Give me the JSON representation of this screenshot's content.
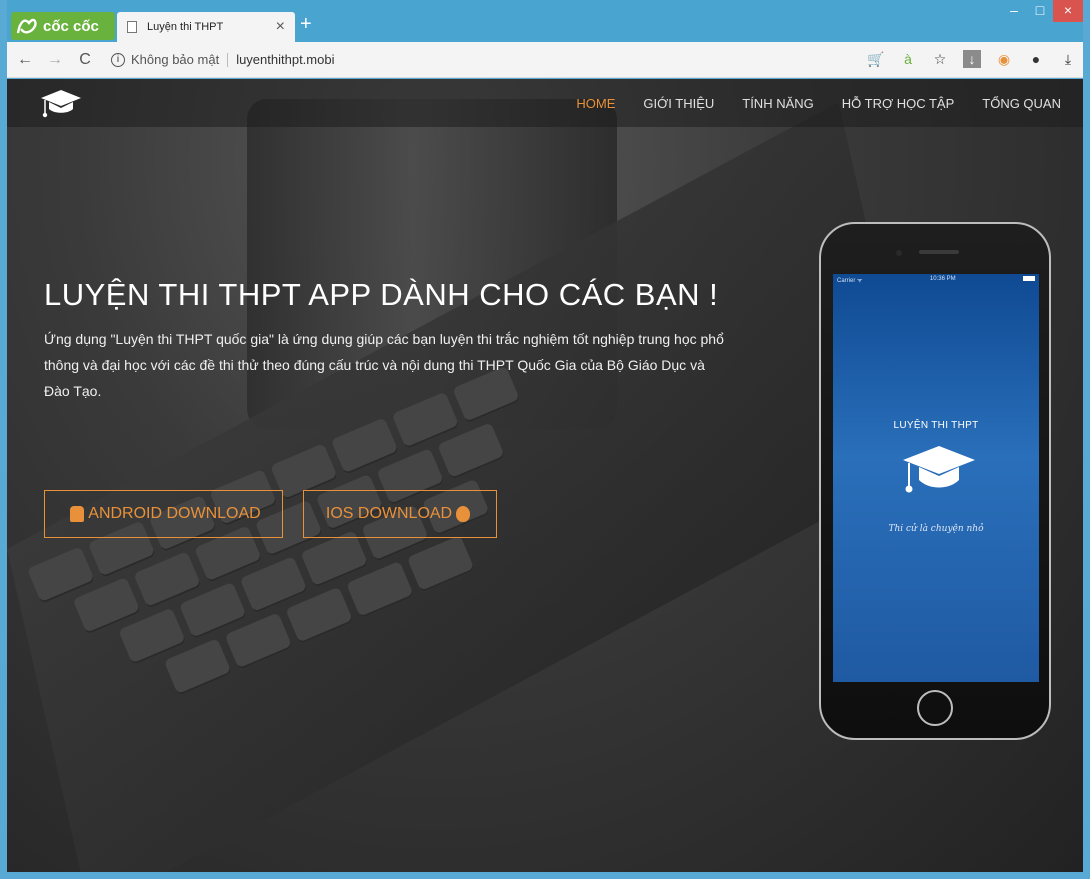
{
  "browser": {
    "brand": "cốc cốc",
    "tab_title": "Luyện thi THPT",
    "tab_close": "×",
    "new_tab": "+",
    "address": {
      "security_label": "Không bảo mật",
      "url": "luyenthithpt.mobi"
    },
    "window_controls": {
      "minimize": "–",
      "maximize": "□",
      "close": "×"
    },
    "accent": "#4aa4d0"
  },
  "site": {
    "nav": [
      {
        "label": "HOME",
        "active": true
      },
      {
        "label": "GIỚI THIỆU",
        "active": false
      },
      {
        "label": "TÍNH NĂNG",
        "active": false
      },
      {
        "label": "HỖ TRỢ HỌC TẬP",
        "active": false
      },
      {
        "label": "TỔNG QUAN",
        "active": false
      }
    ],
    "hero": {
      "headline": "LUYỆN THI THPT APP DÀNH CHO CÁC BẠN !",
      "description": "Ứng dụng \"Luyện thi THPT quốc gia\" là ứng dụng giúp các bạn luyện thi trắc nghiệm tốt nghiệp trung học phổ thông và đại học với các đề thi thử theo đúng cấu trúc và nội dung thi THPT Quốc Gia của Bộ Giáo Dục và Đào Tạo.",
      "android_button": "ANDROID DOWNLOAD",
      "ios_button": "IOS DOWNLOAD"
    },
    "phone": {
      "status_carrier": "Carrier ᯤ",
      "status_time": "10:36 PM",
      "app_title": "LUYỆN THI THPT",
      "app_tagline": "Thi cử là chuyện nhỏ"
    },
    "colors": {
      "accent_orange": "#e8913a",
      "screen_blue": "#1f5aa3"
    }
  }
}
